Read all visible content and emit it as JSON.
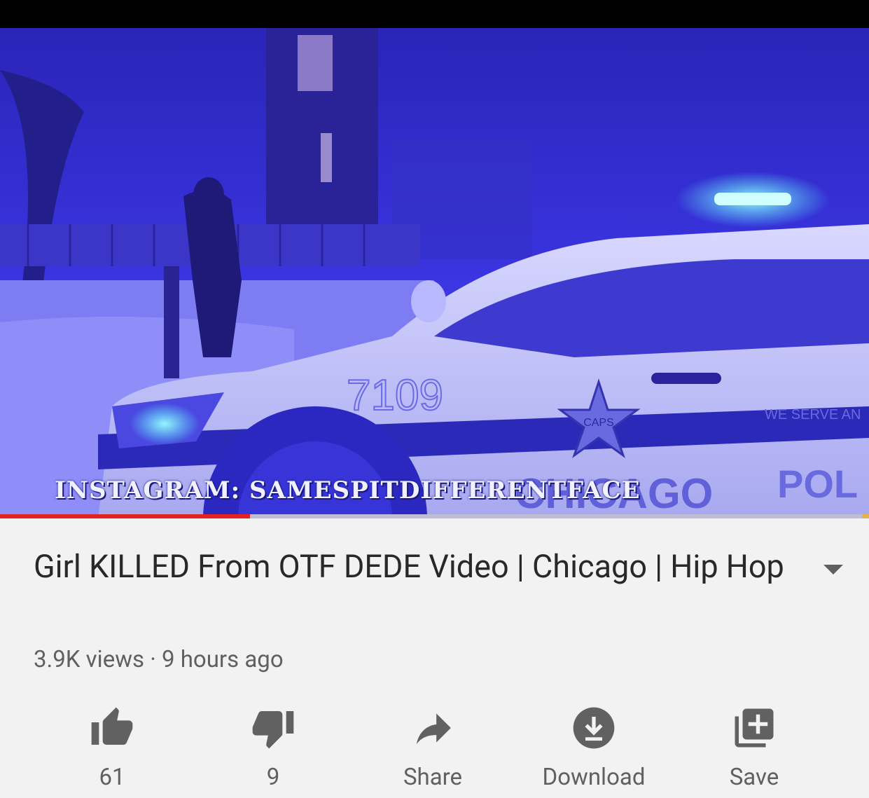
{
  "video": {
    "overlay_text": "INSTAGRAM: SAMESPITDIFFERENTFACE",
    "car_number": "7109",
    "car_text_chicago": "CHICAGO",
    "car_text_police": "POL",
    "car_text_serve": "WE SERVE AN",
    "car_badge": "CAPS",
    "progress_fraction": 0.288
  },
  "title": "Girl KILLED From OTF DEDE Video | Chicago | Hip Hop",
  "meta": "3.9K views · 9 hours ago",
  "actions": {
    "like": {
      "label": "61",
      "icon": "thumbs-up-icon"
    },
    "dislike": {
      "label": "9",
      "icon": "thumbs-down-icon"
    },
    "share": {
      "label": "Share",
      "icon": "share-arrow-icon"
    },
    "download": {
      "label": "Download",
      "icon": "download-icon"
    },
    "save": {
      "label": "Save",
      "icon": "playlist-add-icon"
    }
  },
  "colors": {
    "progress": "#e52222",
    "icon": "#616161",
    "text": "#282828",
    "secondary_text": "#606060"
  }
}
